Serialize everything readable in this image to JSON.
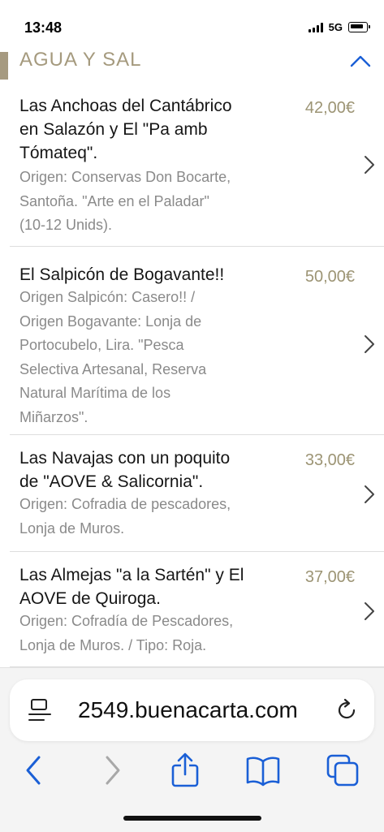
{
  "status_bar": {
    "time": "13:48",
    "network": "5G"
  },
  "section": {
    "title": "AGUA Y SAL"
  },
  "items": [
    {
      "title_lines": [
        "Las Anchoas del Cantábrico",
        "en Salazón y El \"Pa amb",
        "Tómateq\"."
      ],
      "price": "42,00€",
      "desc_lines": [
        "Origen: Conservas Don Bocarte,",
        "Santoña. \"Arte en el Paladar\"",
        "(10-12 Unids)."
      ]
    },
    {
      "title_lines": [
        "El Salpicón de Bogavante!!"
      ],
      "price": "50,00€",
      "desc_lines": [
        "Origen Salpicón: Casero!! /",
        "Origen Bogavante: Lonja de",
        "Portocubelo, Lira. \"Pesca",
        "Selectiva Artesanal, Reserva",
        "Natural Marítima de los",
        "Miñarzos\"."
      ]
    },
    {
      "title_lines": [
        "Las Navajas con un poquito",
        "de \"AOVE & Salicornia\"."
      ],
      "price": "33,00€",
      "desc_lines": [
        "Origen: Cofradia de pescadores,",
        "Lonja de Muros."
      ]
    },
    {
      "title_lines": [
        "Las Almejas \"a la Sartén\" y El",
        "AOVE de Quiroga."
      ],
      "price": "37,00€",
      "desc_lines": [
        "Origen: Cofradía de Pescadores,",
        "Lonja de Muros. / Tipo: Roja."
      ]
    }
  ],
  "browser": {
    "url": "2549.buenacarta.com"
  },
  "colors": {
    "price": "#9c9474",
    "accent": "#a69a80",
    "link_blue": "#1a5fd6"
  }
}
